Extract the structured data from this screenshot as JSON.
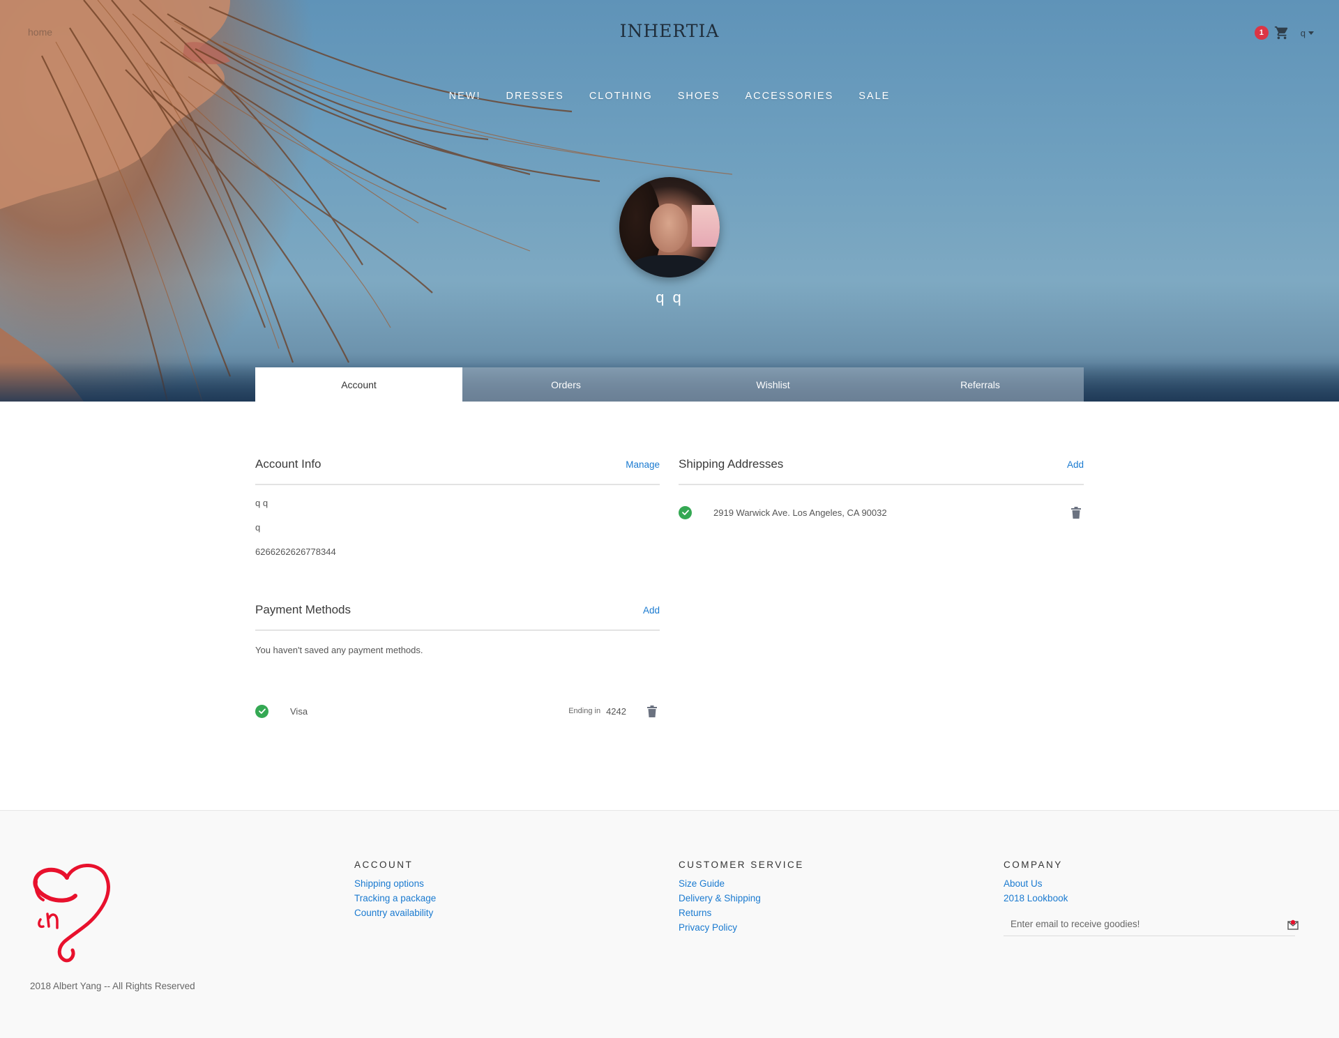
{
  "header": {
    "left_text": "home",
    "brand": "INHERTIA",
    "cart_count": "1",
    "user_menu_label": "q"
  },
  "nav": {
    "items": [
      {
        "label": "NEW!"
      },
      {
        "label": "DRESSES"
      },
      {
        "label": "CLOTHING"
      },
      {
        "label": "SHOES"
      },
      {
        "label": "ACCESSORIES"
      },
      {
        "label": "SALE"
      }
    ]
  },
  "profile": {
    "name": "q q"
  },
  "tabs": [
    {
      "label": "Account",
      "active": true
    },
    {
      "label": "Orders",
      "active": false
    },
    {
      "label": "Wishlist",
      "active": false
    },
    {
      "label": "Referrals",
      "active": false
    }
  ],
  "account_info": {
    "title": "Account Info",
    "action": "Manage",
    "full_name": "q q",
    "username": "q",
    "phone": "6266262626778344"
  },
  "payment_methods": {
    "title": "Payment Methods",
    "action": "Add",
    "empty_note": "You haven't saved any payment methods.",
    "card": {
      "brand": "Visa",
      "ending_label": "Ending in",
      "last4": "4242"
    }
  },
  "shipping": {
    "title": "Shipping Addresses",
    "action": "Add",
    "address": "2919 Warwick Ave. Los Angeles, CA 90032"
  },
  "footer": {
    "copyright": "2018 Albert Yang -- All Rights Reserved",
    "columns": [
      {
        "title": "ACCOUNT",
        "links": [
          "Shipping options",
          "Tracking a package",
          "Country availability"
        ]
      },
      {
        "title": "CUSTOMER SERVICE",
        "links": [
          "Size Guide",
          "Delivery & Shipping",
          "Returns",
          "Privacy Policy"
        ]
      },
      {
        "title": "COMPANY",
        "links": [
          "About Us",
          "2018 Lookbook"
        ]
      }
    ],
    "newsletter_placeholder": "Enter email to receive goodies!"
  },
  "colors": {
    "accent": "#1a7ad0",
    "success": "#34a853",
    "badge": "#dc3545",
    "logo": "#e8112d"
  },
  "icons": {
    "cart": "cart-icon",
    "check": "check-circle-icon",
    "trash": "trash-icon",
    "send": "mail-send-icon"
  }
}
